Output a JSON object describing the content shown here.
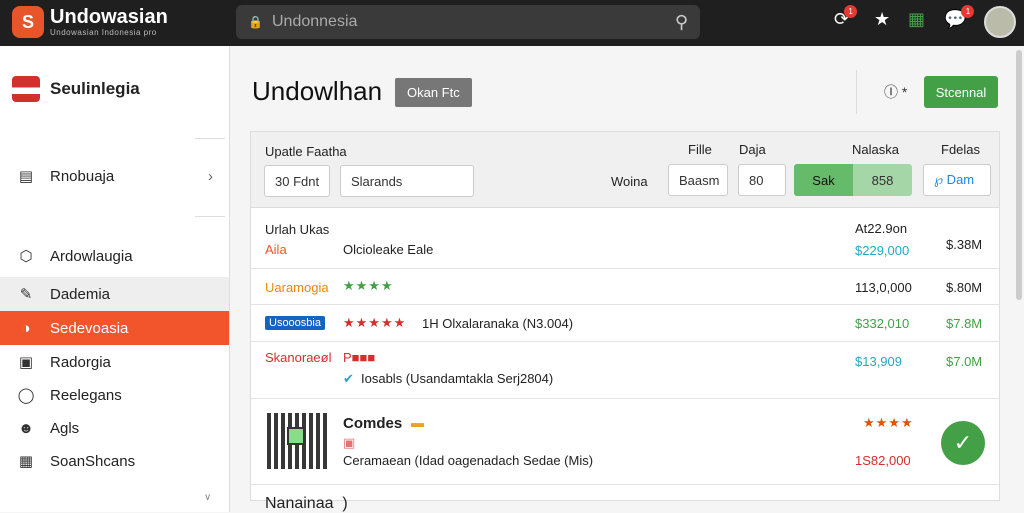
{
  "topbar": {
    "logo_glyph": "S",
    "brand": "Undowasian",
    "brand_sub": "Undowasian Indonesia pro",
    "search_value": "Undonnesia",
    "notif_badge_1": "1",
    "notif_badge_2": "1"
  },
  "sidebar": {
    "brand": "Seulinlegia",
    "items": [
      {
        "label": "Rnobuaja",
        "icon": "list-icon"
      },
      {
        "label": "Ardowlaugia",
        "icon": "hexagon-icon"
      },
      {
        "label": "Dademia",
        "icon": "pen-icon"
      },
      {
        "label": "Sedevoasia",
        "icon": "shield-icon"
      },
      {
        "label": "Radorgia",
        "icon": "image-icon"
      },
      {
        "label": "Reelegans",
        "icon": "pin-icon"
      },
      {
        "label": "Agls",
        "icon": "user-icon"
      },
      {
        "label": "SoanShcans",
        "icon": "table-icon"
      }
    ]
  },
  "main": {
    "title": "Undowlhan",
    "pill": "Okan Ftc",
    "info_label": "Ⓘ *",
    "green_button": "Stcennal"
  },
  "filter": {
    "label_update": "Upatle Faatha",
    "label_file": "Fille",
    "label_daja": "Daja",
    "label_nalaska": "Nalaska",
    "label_fdelas": "Fdelas",
    "input_1": "30 Fdnt",
    "input_2": "Slarands",
    "label_woina": "Woina",
    "input_3": "Baasm",
    "input_4": "80",
    "seg_a": "Sak",
    "seg_b": "858",
    "input_5": "℘ Dam"
  },
  "rows": [
    {
      "name": "Urlah Ukas",
      "sub": "Aila",
      "desc": "Olcioleake Eale",
      "price_top": "At22.9on",
      "price": "$229,000",
      "rate": "$.38M"
    },
    {
      "name": "Uaramogia",
      "stars": "★★★★",
      "price": "113,0,000",
      "rate": "$.80M"
    },
    {
      "name": "Usooosbia",
      "stars": "★★★★★",
      "desc": "1H Olxalaranaka (N3.004)",
      "price": "$332,010",
      "rate": "$7.8M"
    },
    {
      "name": "Skanoraeøl",
      "tag": "P■■■",
      "desc": "Iosabls (Usandamtakla Serj2804)",
      "price": "$13,909",
      "rate": "$7.0M"
    },
    {
      "name": "Comdes",
      "desc": "Ceramaean (Idad oagenadach Sedae (Mis)",
      "stars": "★★★★",
      "price": "1S82,000"
    },
    {
      "name": "Nanainaa  )"
    }
  ]
}
